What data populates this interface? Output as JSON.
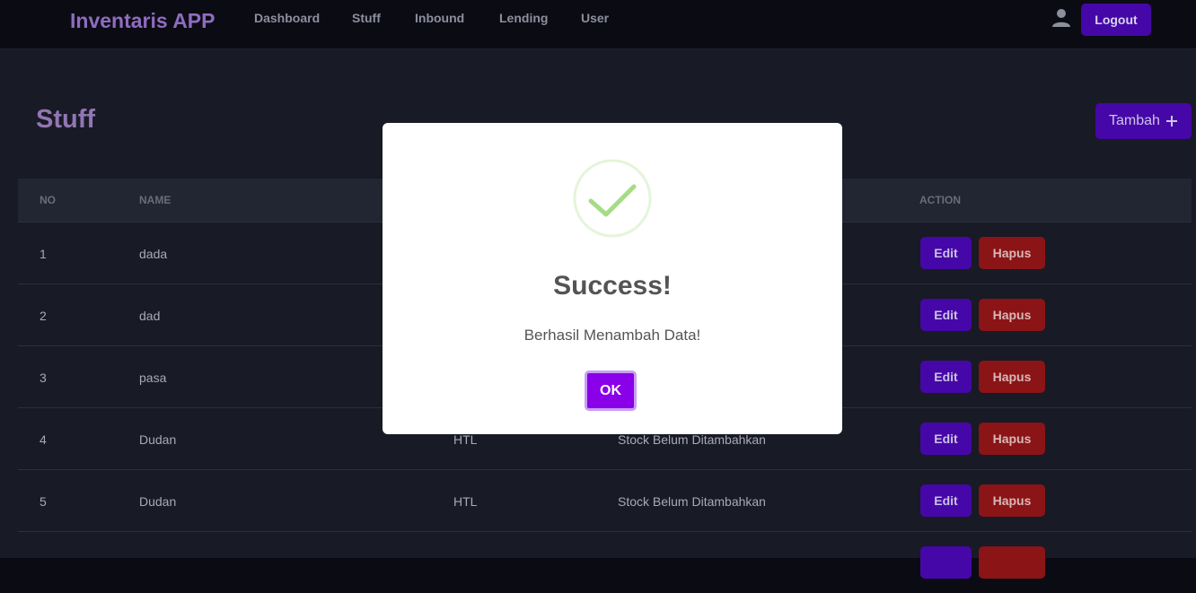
{
  "navbar": {
    "brand": "Inventaris APP",
    "links": [
      "Dashboard",
      "Stuff",
      "Inbound",
      "Lending",
      "User"
    ],
    "user_icon": "user-icon",
    "logout_label": "Logout"
  },
  "page": {
    "title": "Stuff",
    "add_label": "Tambah",
    "add_icon": "plus-icon"
  },
  "table": {
    "headers": {
      "no": "NO",
      "name": "NAME",
      "action": "ACTION"
    },
    "rows": [
      {
        "no": "1",
        "name": "dada",
        "category": "",
        "stock": ""
      },
      {
        "no": "2",
        "name": "dad",
        "category": "",
        "stock": ""
      },
      {
        "no": "3",
        "name": "pasa",
        "category": "",
        "stock": ""
      },
      {
        "no": "4",
        "name": "Dudan",
        "category": "HTL",
        "stock": "Stock Belum Ditambahkan"
      },
      {
        "no": "5",
        "name": "Dudan",
        "category": "HTL",
        "stock": "Stock Belum Ditambahkan"
      }
    ],
    "edit_label": "Edit",
    "delete_label": "Hapus"
  },
  "modal": {
    "icon": "success-check-icon",
    "title": "Success!",
    "text": "Berhasil Menambah Data!",
    "ok_label": "OK"
  },
  "colors": {
    "primary": "#4607a8",
    "danger": "#8a1416",
    "ok": "#8a00e8",
    "success": "#a5dc86"
  }
}
